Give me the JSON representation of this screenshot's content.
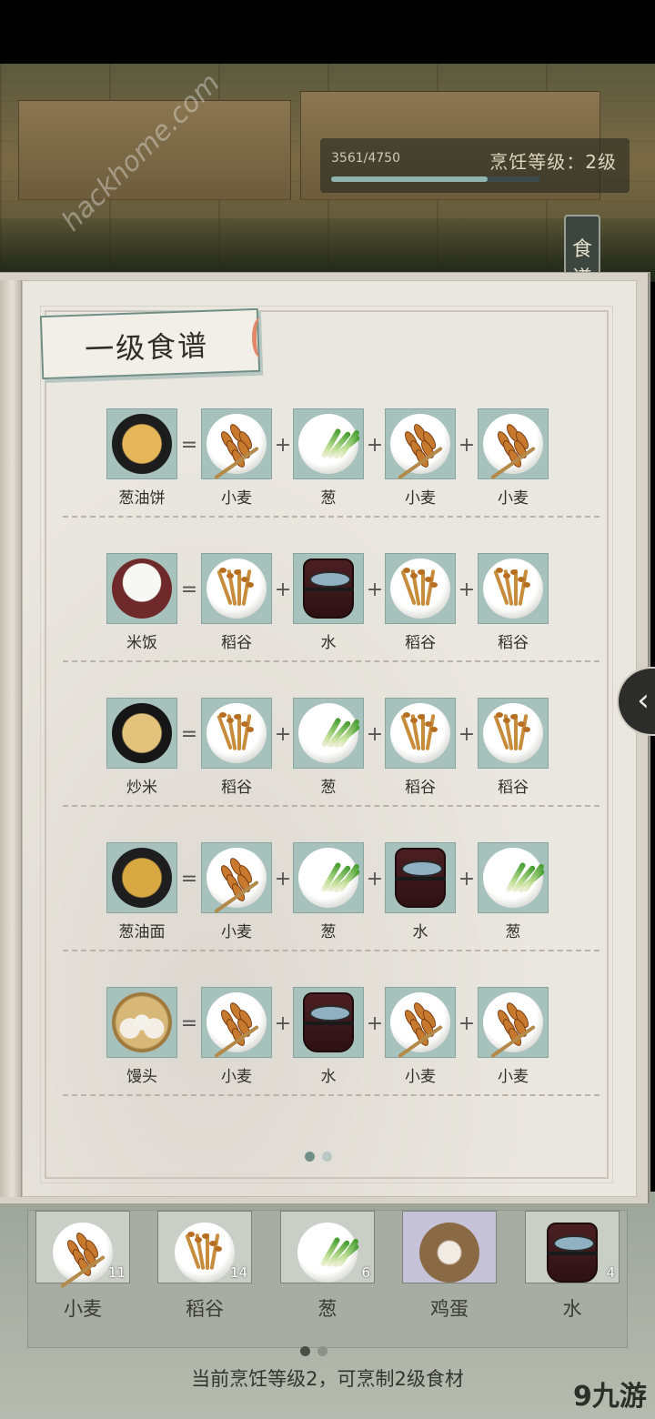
{
  "hud": {
    "exp_text": "3561/4750",
    "exp_progress": 0.7497,
    "level_text": "烹饪等级：2级",
    "recipe_tab": "食谱"
  },
  "book": {
    "title": "一级食谱",
    "page_index": 0,
    "page_count": 2,
    "recipes": [
      {
        "dish": "葱油饼",
        "dish_icon": "scallion-pancake",
        "ingredients": [
          "小麦",
          "葱",
          "小麦",
          "小麦"
        ],
        "ingredient_icons": [
          "wheat",
          "scallion",
          "wheat",
          "wheat"
        ]
      },
      {
        "dish": "米饭",
        "dish_icon": "rice-bowl",
        "ingredients": [
          "稻谷",
          "水",
          "稻谷",
          "稻谷"
        ],
        "ingredient_icons": [
          "rice-stalk",
          "water-bucket",
          "rice-stalk",
          "rice-stalk"
        ]
      },
      {
        "dish": "炒米",
        "dish_icon": "fried-rice",
        "ingredients": [
          "稻谷",
          "葱",
          "稻谷",
          "稻谷"
        ],
        "ingredient_icons": [
          "rice-stalk",
          "scallion",
          "rice-stalk",
          "rice-stalk"
        ]
      },
      {
        "dish": "葱油面",
        "dish_icon": "scallion-noodles",
        "ingredients": [
          "小麦",
          "葱",
          "水",
          "葱"
        ],
        "ingredient_icons": [
          "wheat",
          "scallion",
          "water-bucket",
          "scallion"
        ]
      },
      {
        "dish": "馒头",
        "dish_icon": "steamed-buns",
        "ingredients": [
          "小麦",
          "水",
          "小麦",
          "小麦"
        ],
        "ingredient_icons": [
          "wheat",
          "water-bucket",
          "wheat",
          "wheat"
        ]
      }
    ],
    "equals_sign": "=",
    "plus_sign": "+"
  },
  "inventory": {
    "items": [
      {
        "name": "小麦",
        "count": "11",
        "icon": "wheat"
      },
      {
        "name": "稻谷",
        "count": "14",
        "icon": "rice-stalk"
      },
      {
        "name": "葱",
        "count": "6",
        "icon": "scallion"
      },
      {
        "name": "鸡蛋",
        "count": "",
        "icon": "egg-nest"
      },
      {
        "name": "水",
        "count": "4",
        "icon": "water-bucket"
      }
    ],
    "page_index": 0,
    "page_count": 2,
    "status_text": "当前烹饪等级2，可烹制2级食材",
    "brand": "9九游"
  },
  "watermark": "hackhome.com",
  "colors": {
    "cell_bg": "#a7c1bc",
    "page_bg": "#eae7e0",
    "banner_border": "#6f8f86"
  }
}
